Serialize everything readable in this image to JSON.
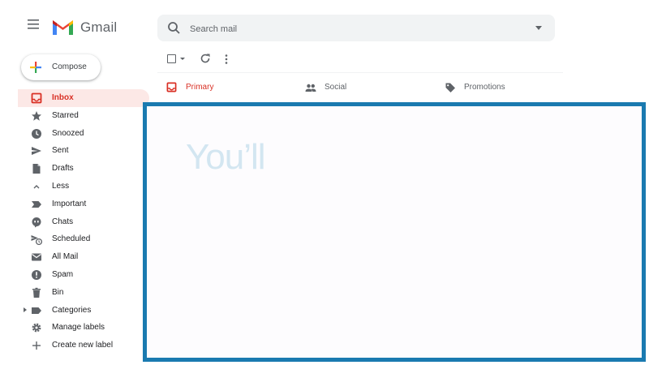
{
  "app": {
    "logo_text": "Gmail"
  },
  "search": {
    "placeholder": "Search mail"
  },
  "compose": {
    "label": "Compose"
  },
  "nav": {
    "items": [
      {
        "label": "Inbox",
        "icon": "inbox-icon",
        "active": true
      },
      {
        "label": "Starred",
        "icon": "star-icon"
      },
      {
        "label": "Snoozed",
        "icon": "clock-icon"
      },
      {
        "label": "Sent",
        "icon": "send-icon"
      },
      {
        "label": "Drafts",
        "icon": "draft-icon"
      },
      {
        "label": "Less",
        "icon": "chevron-up-icon"
      },
      {
        "label": "Important",
        "icon": "important-icon"
      },
      {
        "label": "Chats",
        "icon": "chat-icon"
      },
      {
        "label": "Scheduled",
        "icon": "scheduled-icon"
      },
      {
        "label": "All Mail",
        "icon": "mail-icon"
      },
      {
        "label": "Spam",
        "icon": "spam-icon"
      },
      {
        "label": "Bin",
        "icon": "trash-icon"
      },
      {
        "label": "Categories",
        "icon": "label-icon"
      },
      {
        "label": "Manage labels",
        "icon": "gear-icon"
      },
      {
        "label": "Create new label",
        "icon": "plus-icon"
      }
    ]
  },
  "tabs": [
    {
      "label": "Primary",
      "icon": "inbox-icon"
    },
    {
      "label": "Social",
      "icon": "people-icon"
    },
    {
      "label": "Promotions",
      "icon": "tag-icon"
    }
  ],
  "overlay": {
    "text": "You’ll"
  },
  "colors": {
    "accent": "#d93025",
    "highlight_border": "#1a7ab0",
    "active_bg": "#fce8e6"
  }
}
